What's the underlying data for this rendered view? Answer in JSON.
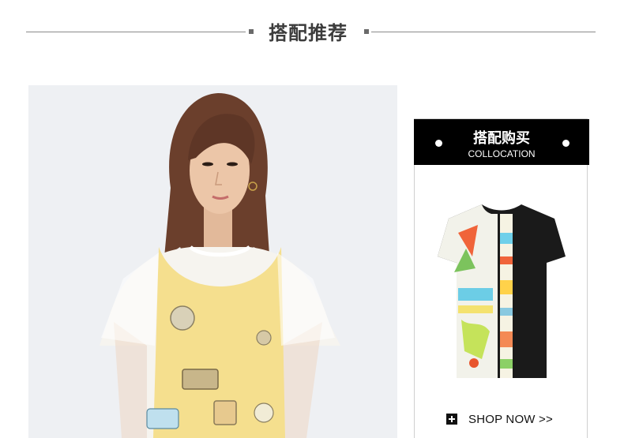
{
  "section": {
    "title": "搭配推荐"
  },
  "collocation": {
    "title_cn": "搭配购买",
    "title_en": "COLLOCATION",
    "shop_now_label": "SHOP NOW >>",
    "shop_icon": "plus-square-icon"
  },
  "colors": {
    "header_text": "#3c3c3c",
    "card_header_bg": "#000000",
    "photo_bg": "#eef0f3",
    "sheer_overlay": "#ffffff",
    "dress_yellow": "#f5df8e"
  }
}
